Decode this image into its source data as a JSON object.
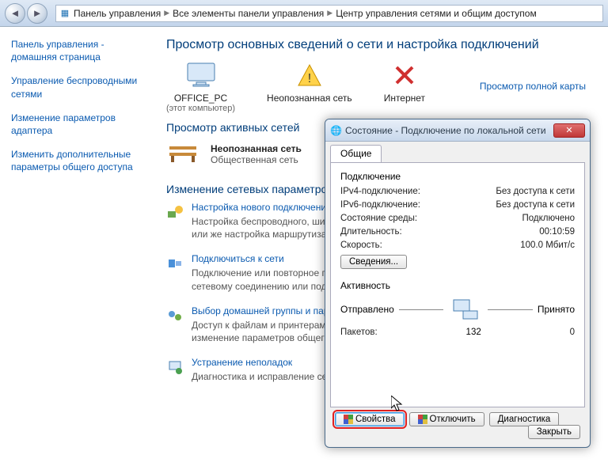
{
  "breadcrumb": {
    "parts": [
      "Панель управления",
      "Все элементы панели управления",
      "Центр управления сетями и общим доступом"
    ]
  },
  "sidebar": {
    "items": [
      "Панель управления - домашняя страница",
      "Управление беспроводными сетями",
      "Изменение параметров адаптера",
      "Изменить дополнительные параметры общего доступа"
    ]
  },
  "content": {
    "heading": "Просмотр основных сведений о сети и настройка подключений",
    "mapLink": "Просмотр полной карты",
    "net": {
      "pc": {
        "label": "OFFICE_PC",
        "sub": "(этот компьютер)"
      },
      "unknown": {
        "label": "Неопознанная сеть"
      },
      "internet": {
        "label": "Интернет"
      }
    },
    "activeHeading": "Просмотр активных сетей",
    "bench": {
      "title": "Неопознанная сеть",
      "sub": "Общественная сеть"
    },
    "paramsHeading": "Изменение сетевых параметров",
    "params": [
      {
        "link": "Настройка нового подключения",
        "desc": "Настройка беспроводного, широкополосного, модемного, прямого или VPN-подключения или же настройка маршрутизатора или точки доступа."
      },
      {
        "link": "Подключиться к сети",
        "desc": "Подключение или повторное подключение к беспроводному, проводному, модемному сетевому соединению или подключение к VPN."
      },
      {
        "link": "Выбор домашней группы и параметров общего доступа",
        "desc": "Доступ к файлам и принтерам, расположенным на других сетевых компьютерах, или изменение параметров общего доступа."
      },
      {
        "link": "Устранение неполадок",
        "desc": "Диагностика и исправление сетевых проблем или получение сведений об исправлении."
      }
    ]
  },
  "dialog": {
    "title": "Состояние - Подключение по локальной сети",
    "tab": "Общие",
    "connection": {
      "heading": "Подключение",
      "rows": {
        "ipv4_k": "IPv4-подключение:",
        "ipv4_v": "Без доступа к сети",
        "ipv6_k": "IPv6-подключение:",
        "ipv6_v": "Без доступа к сети",
        "media_k": "Состояние среды:",
        "media_v": "Подключено",
        "dur_k": "Длительность:",
        "dur_v": "00:10:59",
        "speed_k": "Скорость:",
        "speed_v": "100.0 Мбит/с"
      },
      "detailsBtn": "Сведения..."
    },
    "activity": {
      "heading": "Активность",
      "sent": "Отправлено",
      "recv": "Принято",
      "packets_k": "Пакетов:",
      "packets_sent": "132",
      "packets_recv": "0"
    },
    "buttons": {
      "props": "Свойства",
      "disable": "Отключить",
      "diag": "Диагностика",
      "close": "Закрыть"
    }
  }
}
